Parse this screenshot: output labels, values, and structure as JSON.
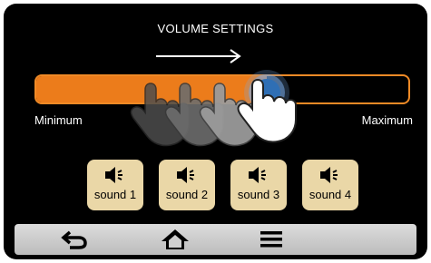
{
  "header": {
    "title": "VOLUME SETTINGS"
  },
  "slider": {
    "min_label": "Minimum",
    "max_label": "Maximum",
    "level": 0.62,
    "fill_color": "#ec7c1b",
    "thumb_color": "#2f6fb5"
  },
  "gesture": {
    "icon": "hand-pointer-icon",
    "direction": "right"
  },
  "sounds": [
    {
      "label": "sound 1",
      "icon": "speaker-icon"
    },
    {
      "label": "sound 2",
      "icon": "speaker-icon"
    },
    {
      "label": "sound 3",
      "icon": "speaker-icon"
    },
    {
      "label": "sound 4",
      "icon": "speaker-icon"
    }
  ],
  "navbar": {
    "items": [
      {
        "icon": "back-arrow-icon"
      },
      {
        "icon": "home-icon"
      },
      {
        "icon": "menu-icon"
      }
    ]
  },
  "colors": {
    "accent": "#ec7c1b",
    "button_bg": "#ead7a7",
    "background": "#000000"
  }
}
